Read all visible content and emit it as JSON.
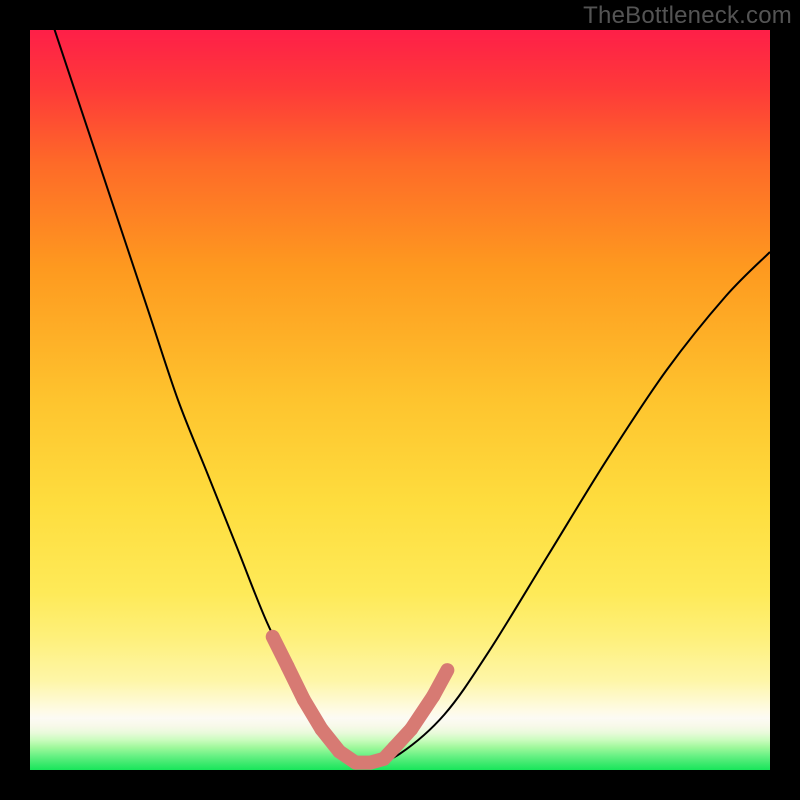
{
  "watermark": "TheBottleneck.com",
  "chart_data": {
    "type": "line",
    "title": "",
    "xlabel": "",
    "ylabel": "",
    "xlim": [
      0,
      1
    ],
    "ylim": [
      0,
      1
    ],
    "series": [
      {
        "name": "bottleneck-curve",
        "x": [
          0.0,
          0.04,
          0.08,
          0.12,
          0.16,
          0.2,
          0.24,
          0.28,
          0.32,
          0.36,
          0.4,
          0.44,
          0.465,
          0.5,
          0.56,
          0.62,
          0.7,
          0.78,
          0.86,
          0.94,
          1.0
        ],
        "y": [
          1.1,
          0.98,
          0.86,
          0.74,
          0.62,
          0.5,
          0.4,
          0.3,
          0.2,
          0.12,
          0.05,
          0.013,
          0.01,
          0.022,
          0.075,
          0.16,
          0.29,
          0.42,
          0.54,
          0.64,
          0.7
        ]
      }
    ],
    "markers": {
      "name": "pinkish-pips",
      "points": [
        {
          "x": 0.328,
          "y": 0.18
        },
        {
          "x": 0.348,
          "y": 0.14
        },
        {
          "x": 0.37,
          "y": 0.095
        },
        {
          "x": 0.394,
          "y": 0.055
        },
        {
          "x": 0.418,
          "y": 0.025
        },
        {
          "x": 0.44,
          "y": 0.01
        },
        {
          "x": 0.46,
          "y": 0.01
        },
        {
          "x": 0.478,
          "y": 0.015
        },
        {
          "x": 0.492,
          "y": 0.03
        },
        {
          "x": 0.515,
          "y": 0.055
        },
        {
          "x": 0.545,
          "y": 0.1
        },
        {
          "x": 0.564,
          "y": 0.135
        }
      ]
    },
    "gradient_stops": [
      {
        "pos": 0.0,
        "color": "#18e65a"
      },
      {
        "pos": 0.07,
        "color": "#fcfbf4"
      },
      {
        "pos": 0.24,
        "color": "#feea58"
      },
      {
        "pos": 0.5,
        "color": "#fec42e"
      },
      {
        "pos": 0.82,
        "color": "#fe6a28"
      },
      {
        "pos": 1.0,
        "color": "#fe1f48"
      }
    ]
  }
}
